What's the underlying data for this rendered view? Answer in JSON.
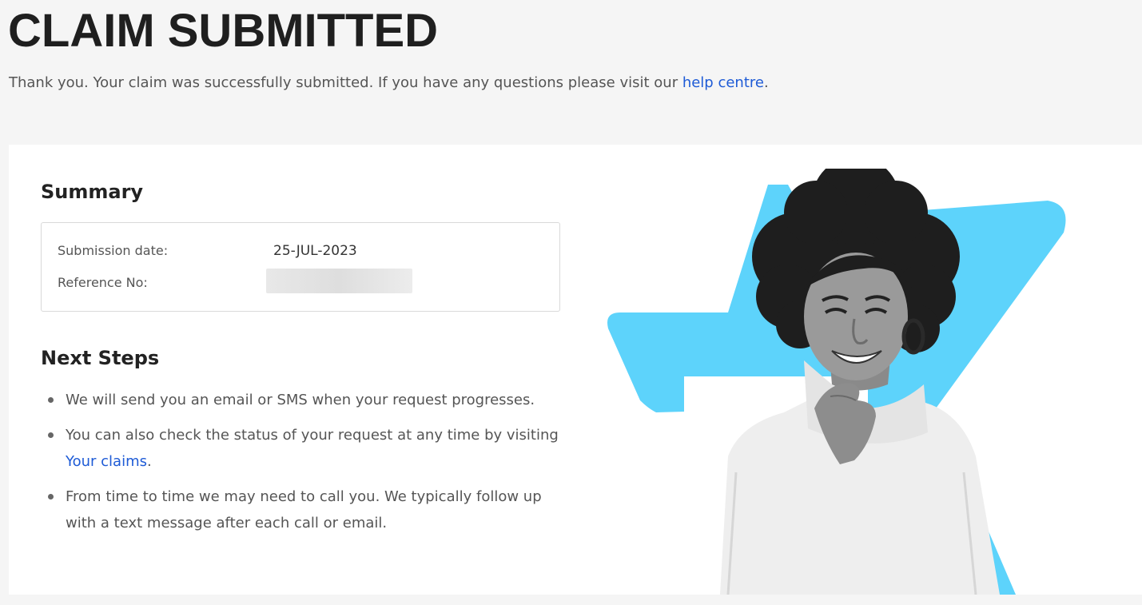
{
  "page": {
    "title": "CLAIM SUBMITTED",
    "intro_text": "Thank you. Your claim was successfully submitted. If you have any questions please visit our ",
    "help_link_label": "help centre",
    "intro_end": "."
  },
  "summary": {
    "heading": "Summary",
    "submission_date_label": "Submission date:",
    "submission_date_value": "25-JUL-2023",
    "reference_label": "Reference No:"
  },
  "next_steps": {
    "heading": "Next Steps",
    "items": [
      {
        "text": "We will send you an email or SMS when your request progresses."
      },
      {
        "text": "You can also check the status of your request at any time by visiting ",
        "link_label": "Your claims",
        "end": "."
      },
      {
        "text": "From time to time we may need to call you. We typically follow up with a text message after each call or email."
      }
    ]
  },
  "colors": {
    "accent_link": "#1e5bd6",
    "hero_shape": "#5dd3fb",
    "title": "#1f1f1f"
  },
  "icons": {
    "bullet": "bullet-dot-icon",
    "hero": "hero-illustration"
  }
}
